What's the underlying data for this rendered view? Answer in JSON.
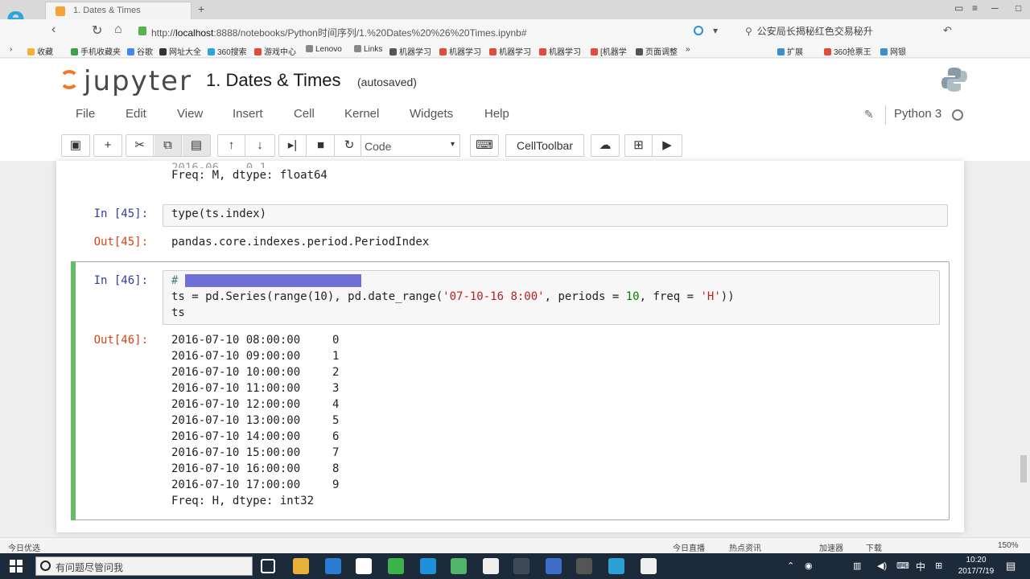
{
  "browser": {
    "tab_title": "1. Dates & Times",
    "new_tab": "+",
    "url_prefix": "http://",
    "url_host": "localhost",
    "url_rest": ":8888/notebooks/Python时间序列/1.%20Dates%20%26%20Times.ipynb#",
    "search_suggest": "公安局长揭秘红色交易秘升",
    "bookmarks": [
      "收藏",
      "手机收藏夹",
      "谷歌",
      "网址大全",
      "360搜索",
      "游戏中心",
      "Lenovo",
      "Links",
      "机器学习",
      "机器学习",
      "机器学习",
      "机器学习",
      "[机器学",
      "页面调整"
    ],
    "bookmarks_right": [
      "扩展",
      "360抢票王",
      "网银"
    ],
    "colors": {
      "accent": "#2aa6da",
      "lock": "#55b24c"
    }
  },
  "jupyter": {
    "logo_text": "jupyter",
    "title": "1. Dates & Times",
    "save_status": "(autosaved)",
    "menu": [
      "File",
      "Edit",
      "View",
      "Insert",
      "Cell",
      "Kernel",
      "Widgets",
      "Help"
    ],
    "kernel": "Python 3",
    "cell_type": "Code",
    "celltoolbar": "CellToolbar",
    "colors": {
      "logo": "#f37726",
      "selected_bar": "#66bb6a",
      "in_prompt": "#303f9f",
      "out_prompt": "#d84315"
    }
  },
  "cells": {
    "partial_output_tail": "Freq: M, dtype: float64",
    "c45": {
      "in_prompt": "In [45]:",
      "code": "type(ts.index)",
      "out_prompt": "Out[45]:",
      "output": "pandas.core.indexes.period.PeriodIndex"
    },
    "c46": {
      "in_prompt": "In [46]:",
      "comment_hash": "#",
      "line2_a": "ts = pd.Series(range(10), pd.date_range(",
      "line2_str": "'07-10-16 8:00'",
      "line2_b": ", periods = ",
      "line2_num": "10",
      "line2_c": ", freq = ",
      "line2_str2": "'H'",
      "line2_d": "))",
      "line3": "ts",
      "out_prompt": "Out[46]:",
      "rows": [
        {
          "ts": "2016-07-10 08:00:00",
          "v": "0"
        },
        {
          "ts": "2016-07-10 09:00:00",
          "v": "1"
        },
        {
          "ts": "2016-07-10 10:00:00",
          "v": "2"
        },
        {
          "ts": "2016-07-10 11:00:00",
          "v": "3"
        },
        {
          "ts": "2016-07-10 12:00:00",
          "v": "4"
        },
        {
          "ts": "2016-07-10 13:00:00",
          "v": "5"
        },
        {
          "ts": "2016-07-10 14:00:00",
          "v": "6"
        },
        {
          "ts": "2016-07-10 15:00:00",
          "v": "7"
        },
        {
          "ts": "2016-07-10 16:00:00",
          "v": "8"
        },
        {
          "ts": "2016-07-10 17:00:00",
          "v": "9"
        }
      ],
      "freq_line": "Freq: H, dtype: int32"
    }
  },
  "statusbar": {
    "left": "今日优选",
    "items": [
      "今日直播",
      "热点资讯",
      "加速器",
      "下载"
    ],
    "zoom": "150%"
  },
  "taskbar": {
    "search_placeholder": "有问题尽管问我",
    "ime": "中",
    "time": "10:20",
    "date": "2017/7/19"
  }
}
